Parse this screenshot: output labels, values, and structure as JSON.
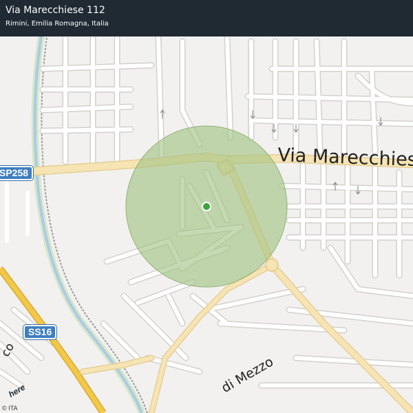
{
  "header": {
    "title": "Via Marecchiese 112",
    "subtitle": "Rimini, Emilia Romagna, Italia"
  },
  "road_labels": {
    "main_street": "Via  Marecchiese",
    "lower_street": "di  Mezzo",
    "partial_left": "co"
  },
  "shields": {
    "sp": "SP258",
    "ss": "SS16"
  },
  "branding": {
    "logo": "here",
    "copyright": "© ITA"
  },
  "colors": {
    "header_bg": "#1f2a33",
    "map_bg": "#f2f1ef",
    "street": "#ffffff",
    "street_outline": "#d3d1cc",
    "main_road": "#f7e4b4",
    "highway": "#f2c84b",
    "river": "#a9cbe8",
    "railway": "#9a9a9a",
    "accuracy_circle": "#a2c283",
    "location_dot": "#3aa63a",
    "shield_blue": "#3f7fc0"
  },
  "icons": {
    "location_marker": "location-dot-icon",
    "one_way_arrows": "one-way-arrow-icon"
  }
}
